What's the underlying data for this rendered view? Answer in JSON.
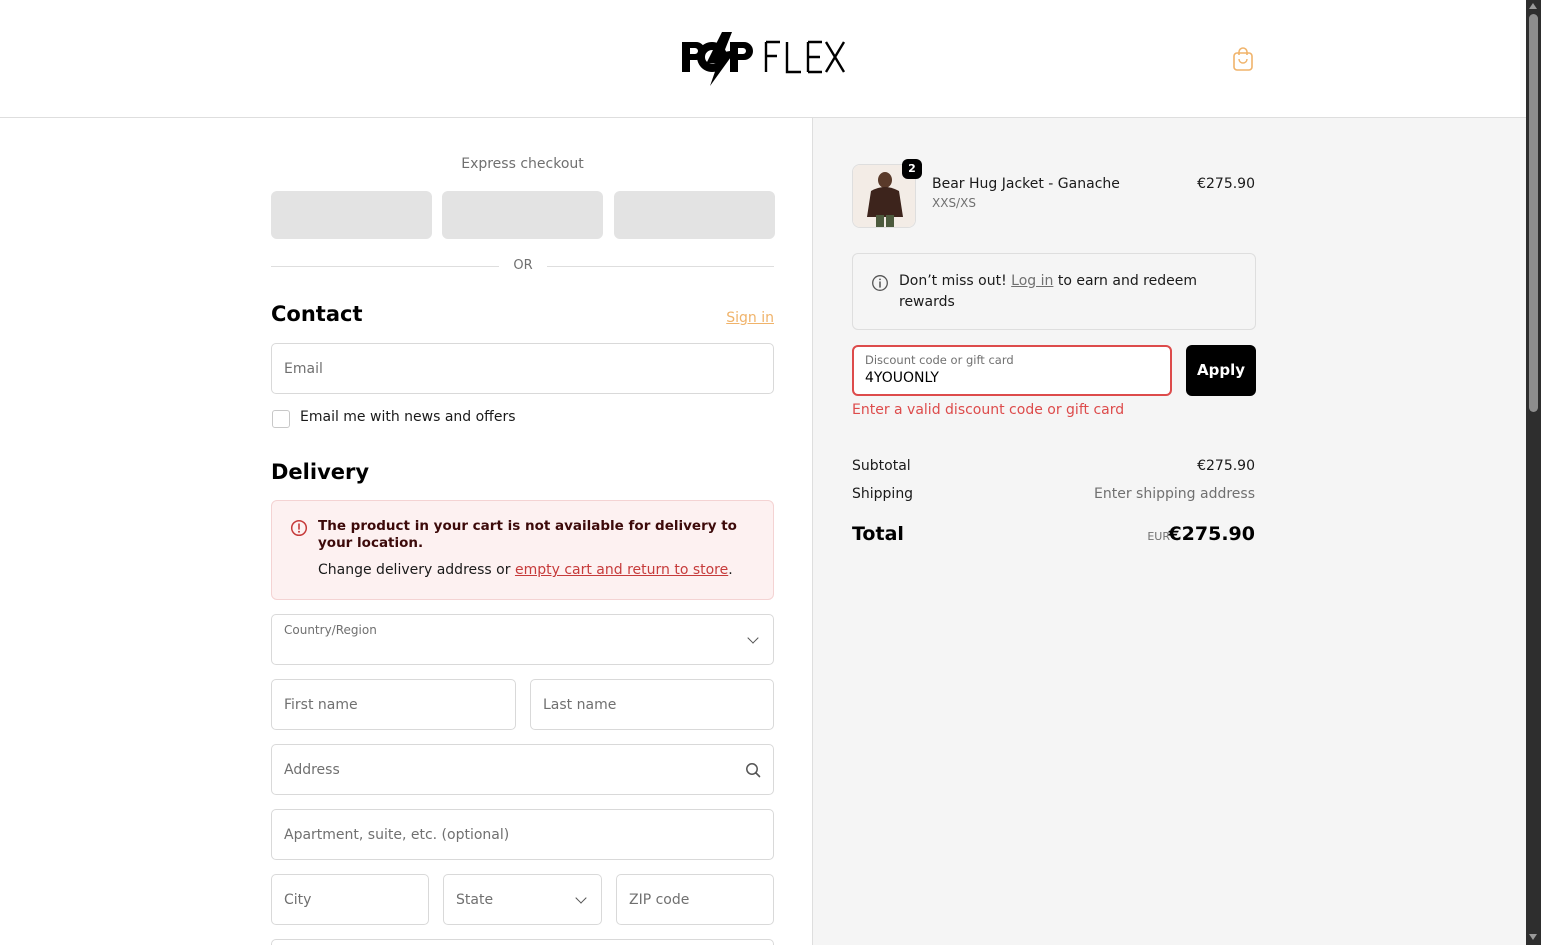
{
  "header": {
    "logo_alt": "PopFlex",
    "cart_icon": "shopping-bag-icon"
  },
  "express": {
    "title": "Express checkout",
    "or": "OR"
  },
  "contact": {
    "title": "Contact",
    "sign_in": "Sign in",
    "email_placeholder": "Email",
    "newsletter_label": "Email me with news and offers"
  },
  "delivery": {
    "title": "Delivery",
    "alert": {
      "title": "The product in your cart is not available for delivery to your location.",
      "body_prefix": "Change delivery address or ",
      "link": "empty cart and return to store",
      "body_suffix": "."
    },
    "country_label": "Country/Region",
    "first_name": "First name",
    "last_name": "Last name",
    "address": "Address",
    "apartment": "Apartment, suite, etc. (optional)",
    "city": "City",
    "state": "State",
    "zip": "ZIP code"
  },
  "summary": {
    "product": {
      "name": "Bear Hug Jacket - Ganache",
      "variant": "XXS/XS",
      "price": "€275.90",
      "quantity": "2"
    },
    "rewards": {
      "prefix": "Don’t miss out! ",
      "link": "Log in",
      "suffix": " to earn and redeem rewards"
    },
    "discount": {
      "label": "Discount code or gift card",
      "value": "4YOUONLY",
      "apply": "Apply",
      "error": "Enter a valid discount code or gift card"
    },
    "subtotal_label": "Subtotal",
    "subtotal_value": "€275.90",
    "shipping_label": "Shipping",
    "shipping_value": "Enter shipping address",
    "total_label": "Total",
    "total_currency": "EUR",
    "total_value": "€275.90"
  },
  "colors": {
    "accent": "#f0b36a",
    "error": "#dd4b4b",
    "summary_bg": "#f5f5f5"
  }
}
